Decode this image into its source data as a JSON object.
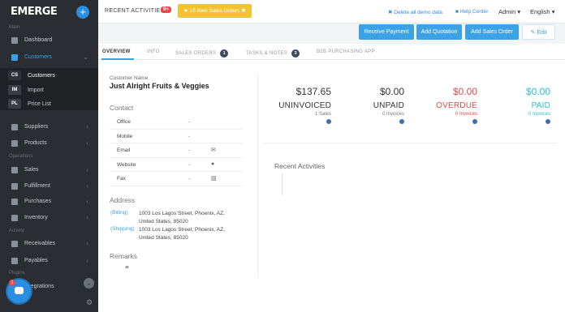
{
  "sidebar": {
    "brand": "EMERGE",
    "plus": "+",
    "section_main": "Main",
    "section_operations": "Operations",
    "section_activity": "Activity",
    "section_plugins": "Plugins",
    "items": [
      {
        "label": "Dashboard",
        "icon": "dashboard-icon"
      },
      {
        "label": "Customers",
        "icon": "users-icon"
      },
      {
        "label": "Suppliers",
        "icon": "truck-icon"
      },
      {
        "label": "Products",
        "icon": "tag-icon"
      },
      {
        "label": "Sales",
        "icon": "sales-icon"
      },
      {
        "label": "Fulfillment",
        "icon": "box-icon"
      },
      {
        "label": "Purchases",
        "icon": "cart-icon"
      },
      {
        "label": "Inventory",
        "icon": "inventory-icon"
      },
      {
        "label": "Receivables",
        "icon": "receivables-icon"
      },
      {
        "label": "Payables",
        "icon": "payables-icon"
      },
      {
        "label": "Integrations",
        "icon": "plug-icon"
      }
    ],
    "sub_items": [
      {
        "abbr": "CS",
        "label": "Customers"
      },
      {
        "abbr": "IM",
        "label": "Import"
      },
      {
        "abbr": "PL",
        "label": "Price List"
      }
    ],
    "chat_badge": "1"
  },
  "topbar": {
    "recent_activities": "RECENT ACTIVITIES",
    "badge": "9+",
    "notice": "15 New Sales Orders",
    "delete_demo": "Delete all demo data",
    "help_center": "Help Center",
    "user": "Admin",
    "language": "English"
  },
  "actions": {
    "receive_payment": "Receive Payment",
    "add_quotation": "Add Quotation",
    "add_sales_order": "Add Sales Order",
    "edit": "Edit"
  },
  "tabs": [
    {
      "label": "OVERVIEW"
    },
    {
      "label": "INFO"
    },
    {
      "label": "SALES ORDERS",
      "count": "1"
    },
    {
      "label": "TASKS & NOTES",
      "count": "3"
    },
    {
      "label": "B2B PURCHASING APP"
    }
  ],
  "customer": {
    "name_label": "Customer Name",
    "name": "Just Alright Fruits & Veggies",
    "contact_title": "Contact",
    "contacts": [
      {
        "key": "Office",
        "value": "-",
        "icon": ""
      },
      {
        "key": "Mobile",
        "value": "-",
        "icon": ""
      },
      {
        "key": "Email",
        "value": "-",
        "icon": "envelope-icon"
      },
      {
        "key": "Website",
        "value": "-",
        "icon": "globe-icon"
      },
      {
        "key": "Fax",
        "value": "-",
        "icon": "fax-icon"
      }
    ],
    "address_title": "Address",
    "billing_label": "(Billing)",
    "billing_line1": "1003 Los Lagos Street, Phoenix, AZ,",
    "billing_line2": "United States, 85020",
    "shipping_label": "(Shipping)",
    "shipping_line1": "1003 Los Lagos Street, Phoenix, AZ,",
    "shipping_line2": "United States, 85020",
    "remarks_title": "Remarks",
    "remarks_quote": "“"
  },
  "stats": [
    {
      "amount": "$137.65",
      "label": "UNINVOICED",
      "sub": "1 Sales",
      "color": "#333333"
    },
    {
      "amount": "$0.00",
      "label": "UNPAID",
      "sub": "0 Invoices",
      "color": "#333333"
    },
    {
      "amount": "$0.00",
      "label": "OVERDUE",
      "sub": "0 Invoices",
      "color": "#e44b4b"
    },
    {
      "amount": "$0.00",
      "label": "PAID",
      "sub": "0 Invoices",
      "color": "#2bbfd2"
    }
  ],
  "recent_activities_title": "Recent Activities"
}
